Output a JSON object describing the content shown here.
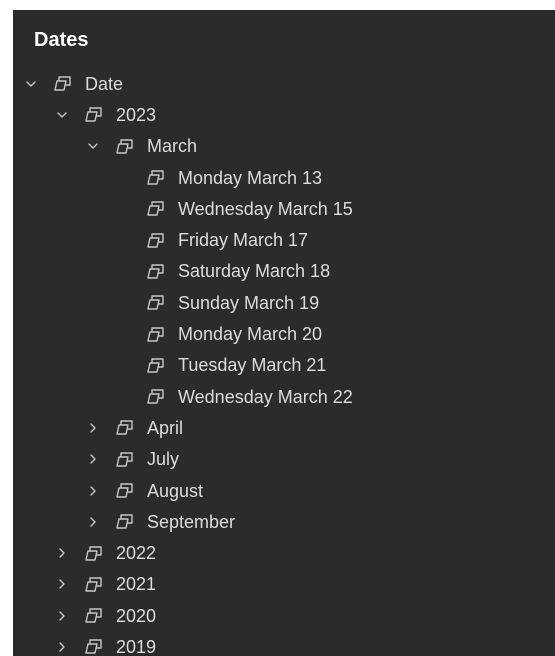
{
  "panel": {
    "title": "Dates"
  },
  "tree": [
    {
      "label": "Date",
      "level": 0,
      "expander": "expanded"
    },
    {
      "label": "2023",
      "level": 1,
      "expander": "expanded"
    },
    {
      "label": "March",
      "level": 2,
      "expander": "expanded"
    },
    {
      "label": "Monday March 13",
      "level": 3,
      "expander": "none"
    },
    {
      "label": "Wednesday March 15",
      "level": 3,
      "expander": "none"
    },
    {
      "label": "Friday March 17",
      "level": 3,
      "expander": "none"
    },
    {
      "label": "Saturday March 18",
      "level": 3,
      "expander": "none"
    },
    {
      "label": "Sunday March 19",
      "level": 3,
      "expander": "none"
    },
    {
      "label": "Monday March 20",
      "level": 3,
      "expander": "none"
    },
    {
      "label": "Tuesday March 21",
      "level": 3,
      "expander": "none"
    },
    {
      "label": "Wednesday March 22",
      "level": 3,
      "expander": "none"
    },
    {
      "label": "April",
      "level": 2,
      "expander": "collapsed"
    },
    {
      "label": "July",
      "level": 2,
      "expander": "collapsed"
    },
    {
      "label": "August",
      "level": 2,
      "expander": "collapsed"
    },
    {
      "label": "September",
      "level": 2,
      "expander": "collapsed"
    },
    {
      "label": "2022",
      "level": 1,
      "expander": "collapsed"
    },
    {
      "label": "2021",
      "level": 1,
      "expander": "collapsed"
    },
    {
      "label": "2020",
      "level": 1,
      "expander": "collapsed"
    },
    {
      "label": "2019",
      "level": 1,
      "expander": "collapsed"
    }
  ],
  "icons": {
    "node": "stack-icon",
    "expanded": "chevron-down-icon",
    "collapsed": "chevron-right-icon"
  },
  "colors": {
    "panel_bg": "#2b2b2b",
    "title": "#ffffff",
    "text": "#dcdcdc",
    "icon": "#c8c8c8"
  }
}
